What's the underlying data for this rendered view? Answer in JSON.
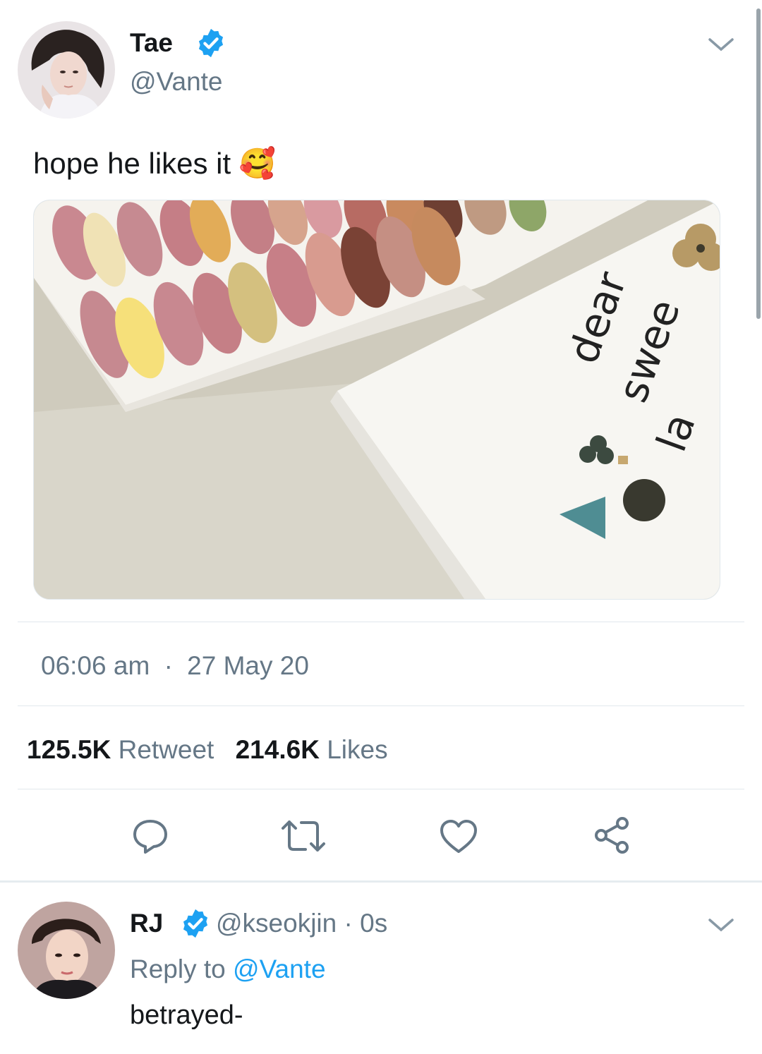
{
  "tweet": {
    "author_name": "Tae",
    "author_handle": "@Vante",
    "text": "hope he likes it",
    "emoji": "🥰",
    "time": "06:06 am",
    "separator": "·",
    "date": "27 May 20",
    "retweet_count": "125.5K",
    "retweet_label": "Retweet",
    "like_count": "214.6K",
    "like_label": "Likes",
    "image_text": [
      "dear",
      "swee",
      "la"
    ]
  },
  "reply": {
    "author_name": "RJ",
    "author_handle": "@kseokjin",
    "dot": "·",
    "time": "0s",
    "reply_to_label": "Reply to",
    "reply_to_handle": "@Vante",
    "text": "betrayed-"
  },
  "actions": [
    "reply-icon",
    "retweet-icon",
    "like-icon",
    "share-icon"
  ],
  "colors": {
    "accent": "#1da1f2",
    "secondary_text": "#657786",
    "primary_text": "#14171a",
    "divider": "#e1e8ed"
  }
}
